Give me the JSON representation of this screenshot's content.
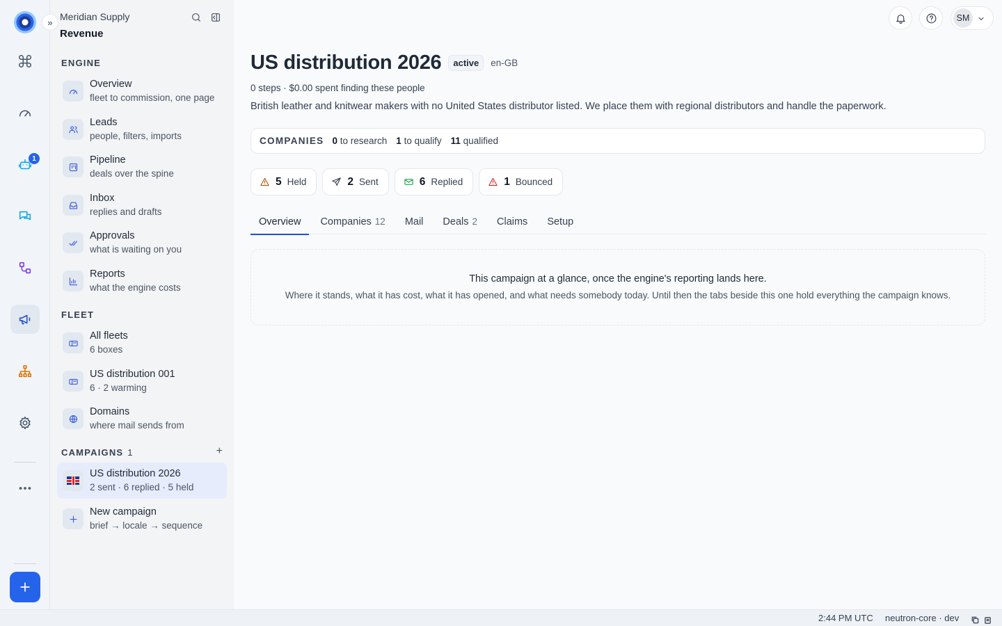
{
  "org": {
    "name": "Meridian Supply",
    "section": "Revenue"
  },
  "rail": {
    "agents_badge": "1"
  },
  "sidebar": {
    "engine_label": "ENGINE",
    "engine_items": [
      {
        "title": "Overview",
        "sub": "fleet to commission, one page",
        "icon": "gauge-icon"
      },
      {
        "title": "Leads",
        "sub": "people, filters, imports",
        "icon": "users-icon"
      },
      {
        "title": "Pipeline",
        "sub": "deals over the spine",
        "icon": "kanban-icon"
      },
      {
        "title": "Inbox",
        "sub": "replies and drafts",
        "icon": "inbox-icon"
      },
      {
        "title": "Approvals",
        "sub": "what is waiting on you",
        "icon": "check-double-icon"
      },
      {
        "title": "Reports",
        "sub": "what the engine costs",
        "icon": "bar-chart-icon"
      }
    ],
    "fleet_label": "FLEET",
    "fleet_items": [
      {
        "title": "All fleets",
        "sub": "6 boxes",
        "icon": "mailbox-icon"
      },
      {
        "title": "US distribution 001",
        "sub": "6 · 2 warming",
        "icon": "mailbox-icon"
      },
      {
        "title": "Domains",
        "sub": "where mail sends from",
        "icon": "globe-icon"
      }
    ],
    "campaigns_label": "CAMPAIGNS",
    "campaigns_count": "1",
    "campaign_items": [
      {
        "title": "US distribution 2026",
        "sub": "2 sent · 6 replied · 5 held",
        "icon": "uk-flag-icon"
      },
      {
        "title": "New campaign",
        "sub": "brief → locale → sequence",
        "icon": "plus-icon"
      }
    ]
  },
  "header": {
    "avatar_initials": "SM"
  },
  "campaign": {
    "title": "US distribution 2026",
    "status": "active",
    "locale": "en-GB",
    "meta": "0 steps · $0.00 spent finding these people",
    "description": "British leather and knitwear makers with no United States distributor listed. We place them with regional distributors and handle the paperwork."
  },
  "companies": {
    "label": "COMPANIES",
    "research_num": "0",
    "research_label": "to research",
    "qualify_num": "1",
    "qualify_label": "to qualify",
    "qualified_num": "11",
    "qualified_label": "qualified"
  },
  "stats": [
    {
      "num": "5",
      "label": "Held",
      "icon": "warning-icon",
      "color": "#b45309"
    },
    {
      "num": "2",
      "label": "Sent",
      "icon": "send-icon",
      "color": "#374151"
    },
    {
      "num": "6",
      "label": "Replied",
      "icon": "mail-icon",
      "color": "#16a34a"
    },
    {
      "num": "1",
      "label": "Bounced",
      "icon": "alert-icon",
      "color": "#dc2626"
    }
  ],
  "tabs": [
    {
      "label": "Overview",
      "count": ""
    },
    {
      "label": "Companies",
      "count": "12"
    },
    {
      "label": "Mail",
      "count": ""
    },
    {
      "label": "Deals",
      "count": "2"
    },
    {
      "label": "Claims",
      "count": ""
    },
    {
      "label": "Setup",
      "count": ""
    }
  ],
  "glance": {
    "title": "This campaign at a glance, once the engine's reporting lands here.",
    "text": "Where it stands, what it has cost, what it has opened, and what needs somebody today. Until then the tabs beside this one hold everything the campaign knows."
  },
  "statusbar": {
    "time": "2:44 PM UTC",
    "env": "neutron-core · dev"
  },
  "colors": {
    "accent": "#2563eb",
    "tab_underline": "#1d4ed8"
  }
}
